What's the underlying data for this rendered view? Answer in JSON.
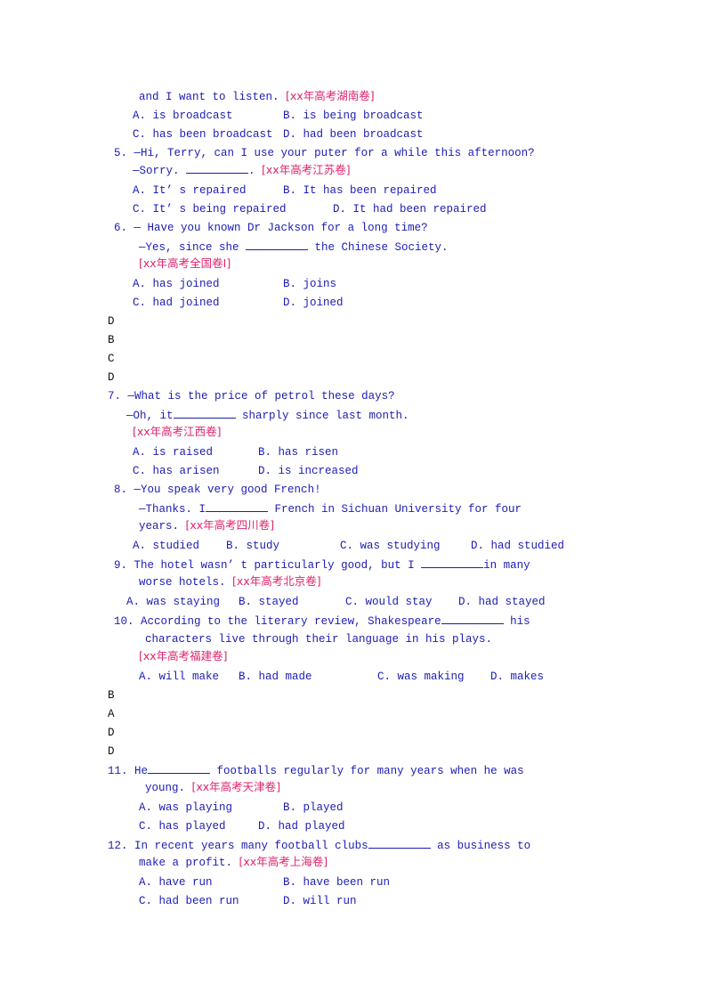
{
  "document": {
    "q4_tail": {
      "text": "and I want to listen. ",
      "source": "[xx年高考湖南卷]",
      "options": [
        "A. is broadcast",
        "B. is being broadcast",
        "C. has been broadcast",
        "D. had been broadcast"
      ]
    },
    "q5": {
      "num": "5.",
      "line1": "—Hi, Terry, can I use your puter for a while this afternoon?",
      "line2a": "—Sorry. ",
      "line2b": ". ",
      "source": "[xx年高考江苏卷]",
      "options": [
        "A. It’ s repaired",
        "B. It has been repaired",
        "C. It’ s being repaired",
        "D. It had been repaired"
      ]
    },
    "q6": {
      "num": "6.",
      "line1": "— Have you known Dr Jackson for a long time?",
      "line2a": "—Yes, since she ",
      "line2b": " the Chinese Society.",
      "source": "[xx年高考全国卷Ⅰ]",
      "options": [
        "A. has joined",
        "B. joins",
        "C. had joined",
        "D. joined"
      ]
    },
    "answers_1": [
      "D",
      "B",
      "C",
      "D"
    ],
    "q7": {
      "num": "7.",
      "line1": "—What is the price of petrol these days?",
      "line2a": "—Oh, it",
      "line2b": " sharply since last month.",
      "source": "[xx年高考江西卷]",
      "options": [
        "A. is raised",
        "B. has risen",
        "C. has arisen",
        "D. is increased"
      ]
    },
    "q8": {
      "num": "8.",
      "line1": "—You speak very good French!",
      "line2a": "—Thanks. I",
      "line2b": " French in Sichuan University for four",
      "line3": "years. ",
      "source": "[xx年高考四川卷]",
      "options": [
        "A. studied",
        "B. study",
        "C. was studying",
        "D. had studied"
      ]
    },
    "q9": {
      "num": "9.",
      "line1a": "The hotel wasn’ t particularly good, but I ",
      "line1b": "in many",
      "line2": "worse hotels. ",
      "source": "[xx年高考北京卷]",
      "options": [
        "A. was staying",
        "B. stayed",
        "C. would stay",
        "D. had stayed"
      ]
    },
    "q10": {
      "num": "10.",
      "line1a": "According to the literary review, Shakespeare",
      "line1b": " his",
      "line2": "characters live through their language in his plays.",
      "source": "[xx年高考福建卷]",
      "options": [
        "A. will make",
        "B. had made",
        "C. was making",
        "D. makes"
      ]
    },
    "answers_2": [
      "B",
      "A",
      "D",
      "D"
    ],
    "q11": {
      "num": "11.",
      "line1a": "He",
      "line1b": " footballs regularly for many years when he was",
      "line2": "young. ",
      "source": "[xx年高考天津卷]",
      "options": [
        "A. was playing",
        "B. played",
        "C. has played",
        "D. had played"
      ]
    },
    "q12": {
      "num": "12.",
      "line1a": "In recent years many football clubs",
      "line1b": " as business to",
      "line2": "make a profit. ",
      "source": "[xx年高考上海卷]",
      "options": [
        "A. have run",
        "B. have been run",
        "C. had been run",
        "D. will run"
      ]
    }
  }
}
